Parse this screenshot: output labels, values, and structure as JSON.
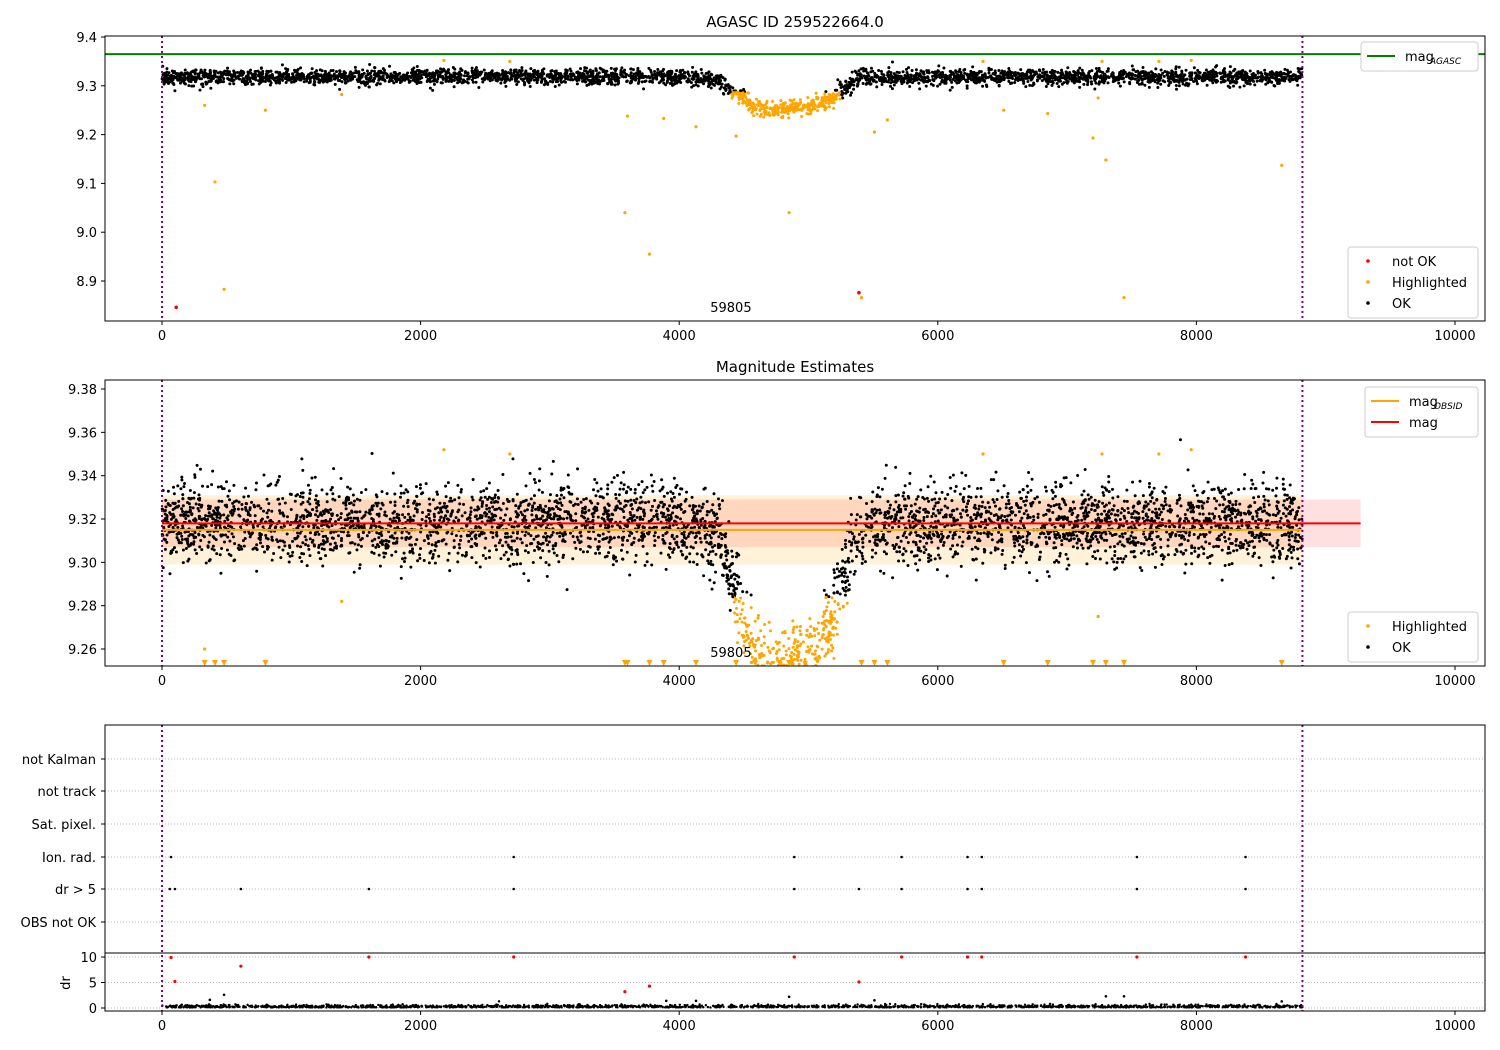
{
  "chart_data": [
    {
      "type": "scatter",
      "title": "AGASC ID 259522664.0",
      "xlim": [
        -450,
        10250
      ],
      "ylim": [
        8.82,
        9.4
      ],
      "xticks": [
        0,
        2000,
        4000,
        6000,
        8000,
        10000
      ],
      "yticks": [
        8.9,
        9.0,
        9.1,
        9.2,
        9.3,
        9.4
      ],
      "ytick_labels": [
        "8.9",
        "9.0",
        "9.1",
        "9.2",
        "9.3",
        "9.4"
      ],
      "mag_agasc": 9.365,
      "obs_range": [
        0,
        8820
      ],
      "annotation": {
        "text": "59805",
        "x": 4400
      },
      "legend_top": [
        {
          "label": "mag",
          "sub": "AGASC",
          "color": "#008000"
        }
      ],
      "legend_bottom": [
        {
          "label": "not OK",
          "color": "#ff0000"
        },
        {
          "label": "Highlighted",
          "color": "#ffa500"
        },
        {
          "label": "OK",
          "color": "#000000"
        }
      ],
      "ok_model": {
        "baseline": 9.318,
        "scatter_sd": 0.009,
        "dip_center": 4850,
        "dip_depth": 0.062,
        "n_points": 3600
      },
      "highlighted": [
        [
          330,
          9.26
        ],
        [
          410,
          9.103
        ],
        [
          480,
          8.883
        ],
        [
          800,
          9.25
        ],
        [
          1390,
          9.282
        ],
        [
          2180,
          9.352
        ],
        [
          2690,
          9.35
        ],
        [
          3580,
          9.04
        ],
        [
          3600,
          9.238
        ],
        [
          3770,
          8.955
        ],
        [
          3880,
          9.233
        ],
        [
          4130,
          9.216
        ],
        [
          4440,
          9.197
        ],
        [
          4850,
          9.04
        ],
        [
          5410,
          8.866
        ],
        [
          5510,
          9.205
        ],
        [
          5610,
          9.23
        ],
        [
          6350,
          9.35
        ],
        [
          6510,
          9.25
        ],
        [
          6850,
          9.243
        ],
        [
          7200,
          9.193
        ],
        [
          7240,
          9.275
        ],
        [
          7270,
          9.35
        ],
        [
          7300,
          9.148
        ],
        [
          7440,
          8.866
        ],
        [
          7710,
          9.35
        ],
        [
          7960,
          9.352
        ],
        [
          8660,
          9.137
        ]
      ],
      "not_ok": [
        [
          110,
          8.846
        ],
        [
          5390,
          8.876
        ]
      ]
    },
    {
      "type": "scatter",
      "title": "Magnitude Estimates",
      "xlim": [
        -450,
        10250
      ],
      "ylim": [
        9.252,
        9.386
      ],
      "xticks": [
        0,
        2000,
        4000,
        6000,
        8000,
        10000
      ],
      "yticks": [
        9.26,
        9.28,
        9.3,
        9.32,
        9.34,
        9.36,
        9.38
      ],
      "ytick_labels": [
        "9.26",
        "9.28",
        "9.30",
        "9.32",
        "9.34",
        "9.36",
        "9.38"
      ],
      "mag": 9.318,
      "mag_range": [
        0,
        9270
      ],
      "mag_band": [
        9.307,
        9.329
      ],
      "mag_obsid": 9.315,
      "mag_obsid_band": [
        9.299,
        9.331
      ],
      "obs_range": [
        0,
        8820
      ],
      "annotation": {
        "text": "59805",
        "x": 4400
      },
      "legend_top": [
        {
          "label": "mag",
          "sub": "OBSID",
          "color": "#ffa500"
        },
        {
          "label": "mag",
          "sub": "",
          "color": "#ff0000"
        }
      ],
      "legend_bottom": [
        {
          "label": "Highlighted",
          "color": "#ffa500"
        },
        {
          "label": "OK",
          "color": "#000000"
        }
      ],
      "below_limit_x": [
        330,
        410,
        480,
        800,
        3580,
        3600,
        3770,
        3880,
        4130,
        4440,
        4850,
        5410,
        5510,
        5610,
        6510,
        6850,
        7200,
        7300,
        7440,
        8660
      ]
    },
    {
      "type": "scatter",
      "title": "",
      "flag_categories": [
        "not Kalman",
        "not track",
        "Sat. pixel.",
        "Ion. rad.",
        "dr > 5",
        "OBS not OK"
      ],
      "flags": {
        "Ion. rad.": [
          70,
          2720,
          4890,
          5720,
          6230,
          6340,
          7540,
          8380
        ],
        "dr > 5": [
          60,
          100,
          610,
          1600,
          2720,
          4890,
          5390,
          5720,
          6230,
          6340,
          7540,
          8380
        ]
      },
      "dr_ylabel": "dr",
      "dr_yticks": [
        0,
        5,
        10
      ],
      "xticks": [
        0,
        2000,
        4000,
        6000,
        8000,
        10000
      ],
      "dr_red": [
        [
          70,
          9.9
        ],
        [
          100,
          5.2
        ],
        [
          610,
          8.2
        ],
        [
          1600,
          10
        ],
        [
          2720,
          10
        ],
        [
          3580,
          3.2
        ],
        [
          3770,
          4.3
        ],
        [
          4890,
          10
        ],
        [
          5390,
          5.1
        ],
        [
          5720,
          10
        ],
        [
          6230,
          10
        ],
        [
          6340,
          10
        ],
        [
          7540,
          10
        ],
        [
          8380,
          10
        ]
      ],
      "dr_black_outliers": [
        [
          370,
          1.6
        ],
        [
          480,
          2.6
        ],
        [
          3900,
          1.4
        ],
        [
          4130,
          1.4
        ],
        [
          4850,
          2.2
        ],
        [
          5510,
          1.5
        ],
        [
          7300,
          2.3
        ],
        [
          7440,
          2.3
        ],
        [
          8660,
          1.3
        ]
      ]
    }
  ]
}
